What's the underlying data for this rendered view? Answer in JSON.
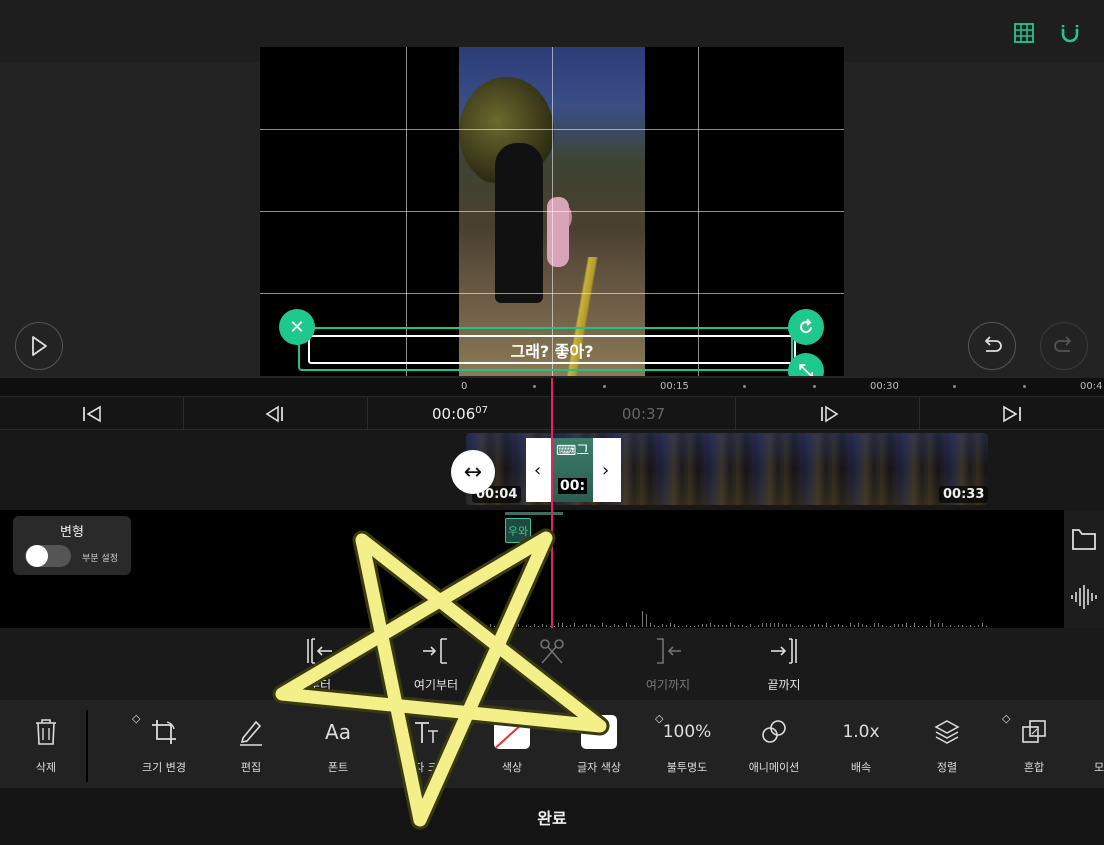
{
  "toolbar_top": {
    "grid_icon": "grid-icon",
    "magnet_icon": "magnet-icon"
  },
  "preview": {
    "caption_text": "그래? 좋아?"
  },
  "ruler": {
    "labels": [
      "0",
      "00:15",
      "00:30",
      "00:4"
    ]
  },
  "transport": {
    "current_time": "00:06",
    "current_frames": "07",
    "duration": "00:37"
  },
  "clip": {
    "start_chip": "00:04",
    "end_chip": "00:33",
    "selected_label": "⌨그",
    "selected_time": "00:"
  },
  "transform": {
    "title": "변형",
    "toggle_label": "부분 설정",
    "enabled": false
  },
  "subtitle_clip": {
    "text": "우와"
  },
  "split": [
    {
      "label": "부터"
    },
    {
      "label": "여기부터"
    },
    {
      "label": ""
    },
    {
      "label": "여기까지"
    },
    {
      "label": "끝까지"
    }
  ],
  "tools": [
    {
      "label": "삭제"
    },
    {
      "label": "크기 변경"
    },
    {
      "label": "편집"
    },
    {
      "label": "폰트",
      "glyph": "Aa"
    },
    {
      "label": "자 크",
      "glyph": "TT"
    },
    {
      "label": "색상"
    },
    {
      "label": "글자 색상"
    },
    {
      "label": "불투명도",
      "value": "100%"
    },
    {
      "label": "애니메이션"
    },
    {
      "label": "배속",
      "value": "1.0x"
    },
    {
      "label": "정렬"
    },
    {
      "label": "혼합"
    },
    {
      "label": "모"
    }
  ],
  "done_label": "완료",
  "colors": {
    "accent": "#1fc98e",
    "playhead": "#e0245e",
    "star": "#f3f08a"
  }
}
